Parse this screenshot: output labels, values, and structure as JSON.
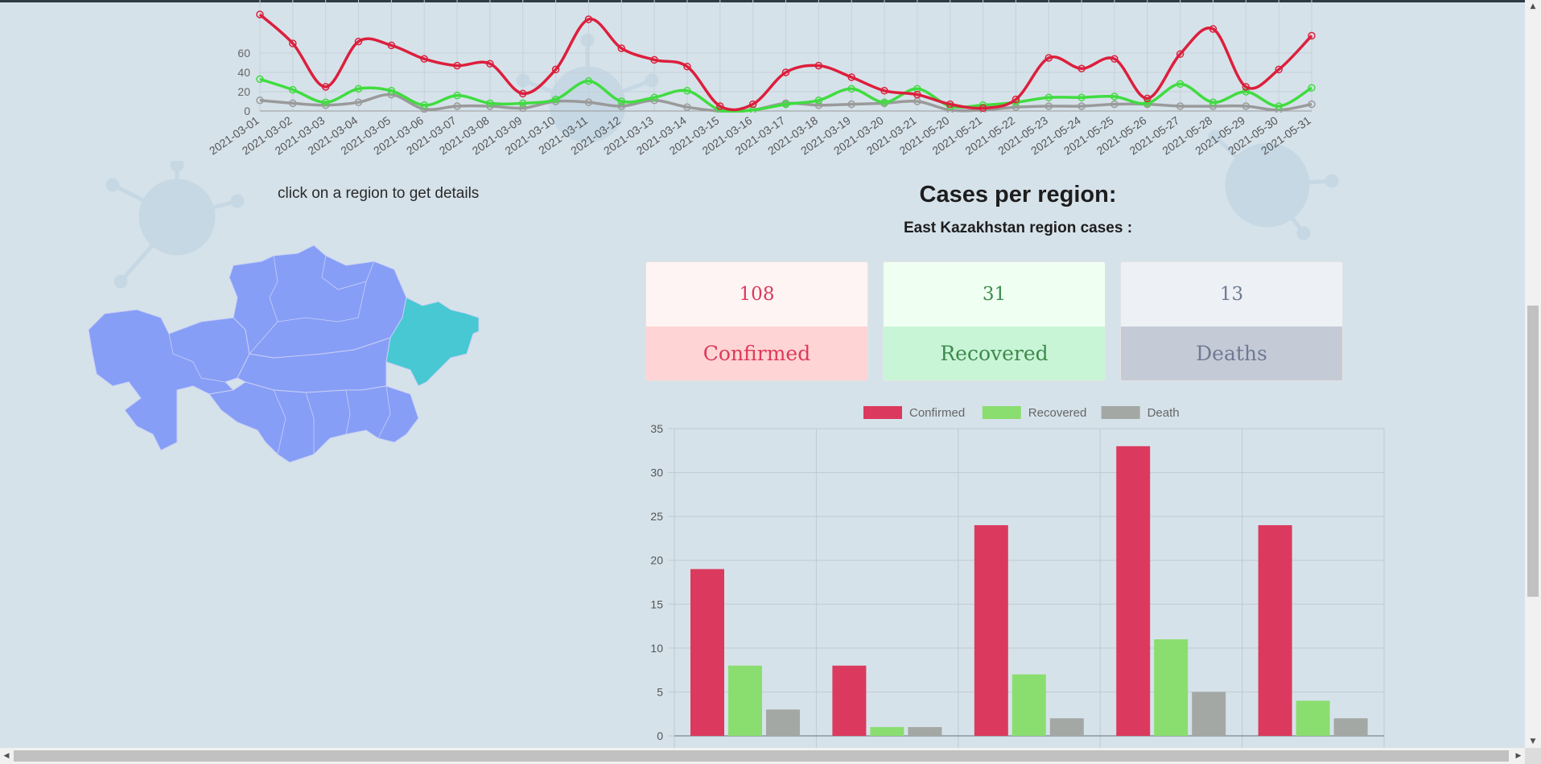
{
  "line_chart": {
    "chart_data": {
      "type": "line",
      "categories": [
        "2021-03-01",
        "2021-03-02",
        "2021-03-03",
        "2021-03-04",
        "2021-03-05",
        "2021-03-06",
        "2021-03-07",
        "2021-03-08",
        "2021-03-09",
        "2021-03-10",
        "2021-03-11",
        "2021-03-12",
        "2021-03-13",
        "2021-03-14",
        "2021-03-15",
        "2021-03-16",
        "2021-03-17",
        "2021-03-18",
        "2021-03-19",
        "2021-03-20",
        "2021-03-21",
        "2021-05-20",
        "2021-05-21",
        "2021-05-22",
        "2021-05-23",
        "2021-05-24",
        "2021-05-25",
        "2021-05-26",
        "2021-05-27",
        "2021-05-28",
        "2021-05-29",
        "2021-05-30",
        "2021-05-31"
      ],
      "y_ticks": [
        "0",
        "20",
        "40",
        "60"
      ],
      "ylim": [
        0,
        80
      ],
      "series": [
        {
          "color": "#dc1f3c",
          "values": [
            100,
            70,
            25,
            72,
            68,
            54,
            47,
            49,
            18,
            43,
            95,
            65,
            53,
            46,
            5,
            7,
            40,
            47,
            35,
            21,
            17,
            7,
            3,
            12,
            55,
            44,
            54,
            13,
            59,
            85,
            25,
            43,
            78
          ]
        },
        {
          "color": "#40dc40",
          "values": [
            33,
            22,
            9,
            23,
            21,
            6,
            16,
            8,
            8,
            12,
            31,
            10,
            14,
            21,
            1,
            1,
            7,
            11,
            23,
            9,
            23,
            5,
            6,
            9,
            14,
            14,
            15,
            8,
            28,
            9,
            20,
            5,
            24
          ]
        },
        {
          "color": "#9a9a9a",
          "values": [
            11,
            8,
            6,
            9,
            17,
            2,
            5,
            5,
            3,
            10,
            9,
            5,
            11,
            4,
            0,
            1,
            8,
            6,
            7,
            8,
            10,
            1,
            1,
            4,
            5,
            5,
            7,
            7,
            5,
            5,
            5,
            1,
            7
          ]
        }
      ]
    }
  },
  "map": {
    "hint": "click on a region to get details",
    "regions": [
      "east-kazakhstan",
      "west",
      "north",
      "central",
      "south"
    ],
    "default_color": "#879ef7",
    "selected_color": "#47c8d2"
  },
  "region": {
    "title": "Cases per region:",
    "subtitle": "East Kazakhstan region cases :"
  },
  "cards": {
    "confirmed": {
      "value": "108",
      "label": "Confirmed"
    },
    "recovered": {
      "value": "31",
      "label": "Recovered"
    },
    "deaths": {
      "value": "13",
      "label": "Deaths"
    }
  },
  "bar_chart": {
    "chart_data": {
      "type": "bar",
      "legend_position": "top",
      "y_ticks": [
        "0",
        "5",
        "10",
        "15",
        "20",
        "25",
        "30",
        "35"
      ],
      "ylim": [
        0,
        35
      ],
      "series": [
        {
          "name": "Confirmed",
          "color": "#db3a5e",
          "values": [
            19,
            8,
            24,
            33,
            24
          ]
        },
        {
          "name": "Recovered",
          "color": "#8ade6f",
          "values": [
            8,
            1,
            7,
            11,
            4
          ]
        },
        {
          "name": "Death",
          "color": "#a4a8a4",
          "values": [
            3,
            1,
            2,
            5,
            2
          ]
        }
      ]
    }
  }
}
